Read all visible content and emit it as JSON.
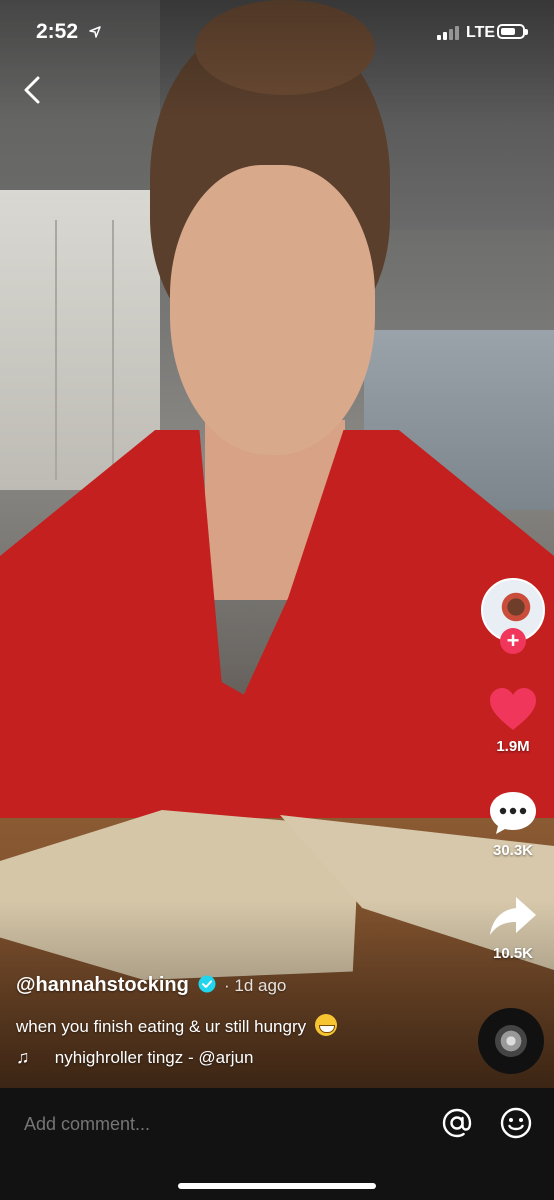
{
  "status_bar": {
    "time": "2:52",
    "network": "LTE",
    "battery_level": 0.7
  },
  "nav": {
    "back_icon": "chevron-left-icon"
  },
  "creator": {
    "avatar_icon": "avatar",
    "follow_icon": "plus-icon",
    "follow_symbol": "+"
  },
  "actions": {
    "likes": "1.9M",
    "comments": "30.3K",
    "shares": "10.5K",
    "like_color": "#f0365b"
  },
  "post": {
    "username": "@hannahstocking",
    "time_ago": "· 1d ago",
    "caption": "when you finish eating & ur still hungry",
    "caption_emoji": "grinning-face-icon",
    "music_symbol": "♫",
    "sound": "nyhighroller tingz - @arjun"
  },
  "comment_bar": {
    "placeholder": "Add comment...",
    "mention_icon": "at-icon",
    "emoji_icon": "smiley-icon"
  }
}
